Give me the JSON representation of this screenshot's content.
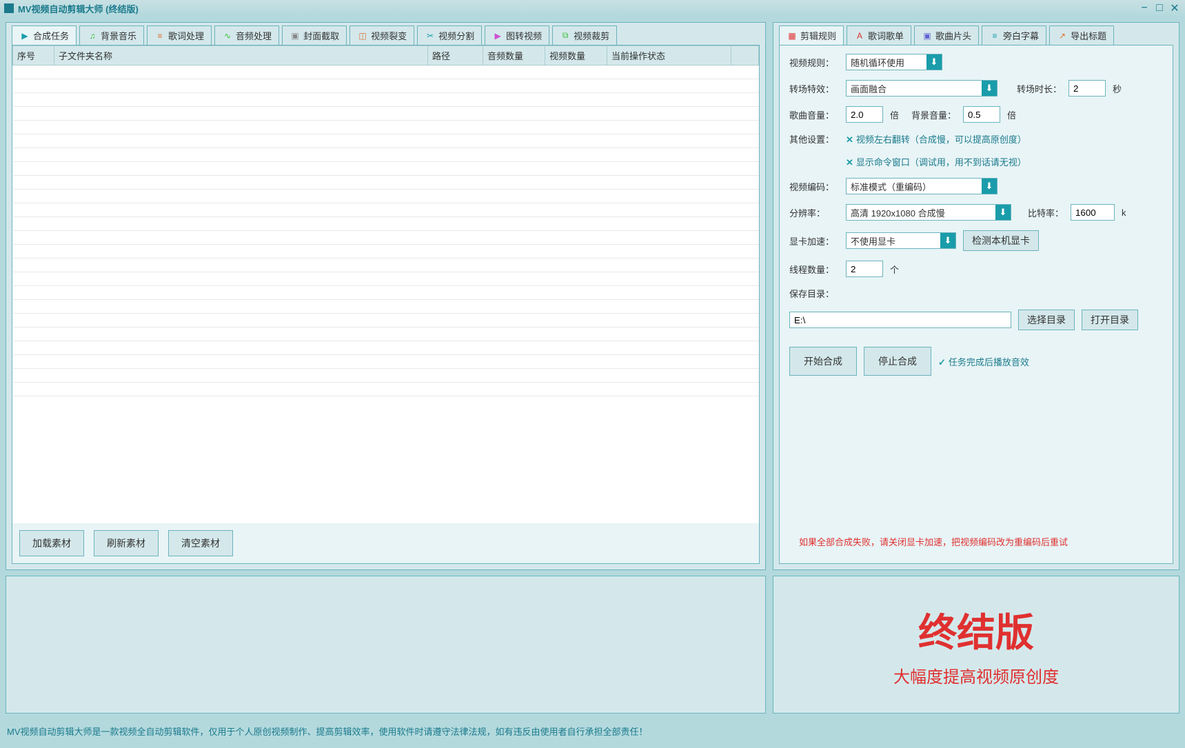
{
  "window": {
    "title": "MV视频自动剪辑大师  (终结版)"
  },
  "tabs_left": [
    {
      "label": "合成任务",
      "icon": "play",
      "color": "#1a9caa"
    },
    {
      "label": "背景音乐",
      "icon": "music",
      "color": "#3cbf3c"
    },
    {
      "label": "歌词处理",
      "icon": "lyrics",
      "color": "#e07030"
    },
    {
      "label": "音频处理",
      "icon": "audio",
      "color": "#3cbf3c"
    },
    {
      "label": "封面截取",
      "icon": "image",
      "color": "#888"
    },
    {
      "label": "视频裂变",
      "icon": "split",
      "color": "#e07030"
    },
    {
      "label": "视频分割",
      "icon": "cut",
      "color": "#1a9caa"
    },
    {
      "label": "图转视频",
      "icon": "convert",
      "color": "#d050d0"
    },
    {
      "label": "视频裁剪",
      "icon": "crop",
      "color": "#3cbf3c"
    }
  ],
  "tabs_right": [
    {
      "label": "剪辑规则",
      "color": "#e03030"
    },
    {
      "label": "歌词歌单",
      "color": "#e03030"
    },
    {
      "label": "歌曲片头",
      "color": "#6060d0"
    },
    {
      "label": "旁白字幕",
      "color": "#1a9caa"
    },
    {
      "label": "导出标题",
      "color": "#e07030"
    }
  ],
  "columns": [
    "序号",
    "子文件夹名称",
    "路径",
    "音频数量",
    "视频数量",
    "当前操作状态",
    ""
  ],
  "buttons_left": {
    "load": "加载素材",
    "refresh": "刷新素材",
    "clear": "清空素材"
  },
  "form": {
    "video_rule": {
      "label": "视频规则：",
      "value": "随机循环使用"
    },
    "transition": {
      "label": "转场特效：",
      "value": "画面融合",
      "dur_label": "转场时长：",
      "dur": "2",
      "unit": "秒"
    },
    "song_vol": {
      "label": "歌曲音量：",
      "value": "2.0",
      "unit": "倍"
    },
    "bg_vol": {
      "label": "背景音量：",
      "value": "0.5",
      "unit": "倍"
    },
    "other": {
      "label": "其他设置：",
      "flip": "视频左右翻转（合成慢，可以提高原创度）",
      "cmd": "显示命令窗口（调试用，用不到话请无视）"
    },
    "encode": {
      "label": "视频编码：",
      "value": "标准模式（重编码）"
    },
    "res": {
      "label": "分辨率：",
      "value": "高清 1920x1080 合成慢",
      "bit_label": "比特率：",
      "bit": "1600",
      "unit": "k"
    },
    "gpu": {
      "label": "显卡加速：",
      "value": "不使用显卡",
      "btn": "检测本机显卡"
    },
    "threads": {
      "label": "线程数量：",
      "value": "2",
      "unit": "个"
    },
    "save": {
      "label": "保存目录：",
      "value": "E:\\",
      "choose": "选择目录",
      "open": "打开目录"
    },
    "start": "开始合成",
    "stop": "停止合成",
    "sound": "任务完成后播放音效",
    "warn": "如果全部合成失败，请关闭显卡加速，把视频编码改为重编码后重试"
  },
  "promo": {
    "title": "终结版",
    "sub": "大幅度提高视频原创度"
  },
  "footer": "MV视频自动剪辑大师是一款视频全自动剪辑软件，仅用于个人原创视频制作、提高剪辑效率，使用软件时请遵守法律法规，如有违反由使用者自行承担全部责任！"
}
